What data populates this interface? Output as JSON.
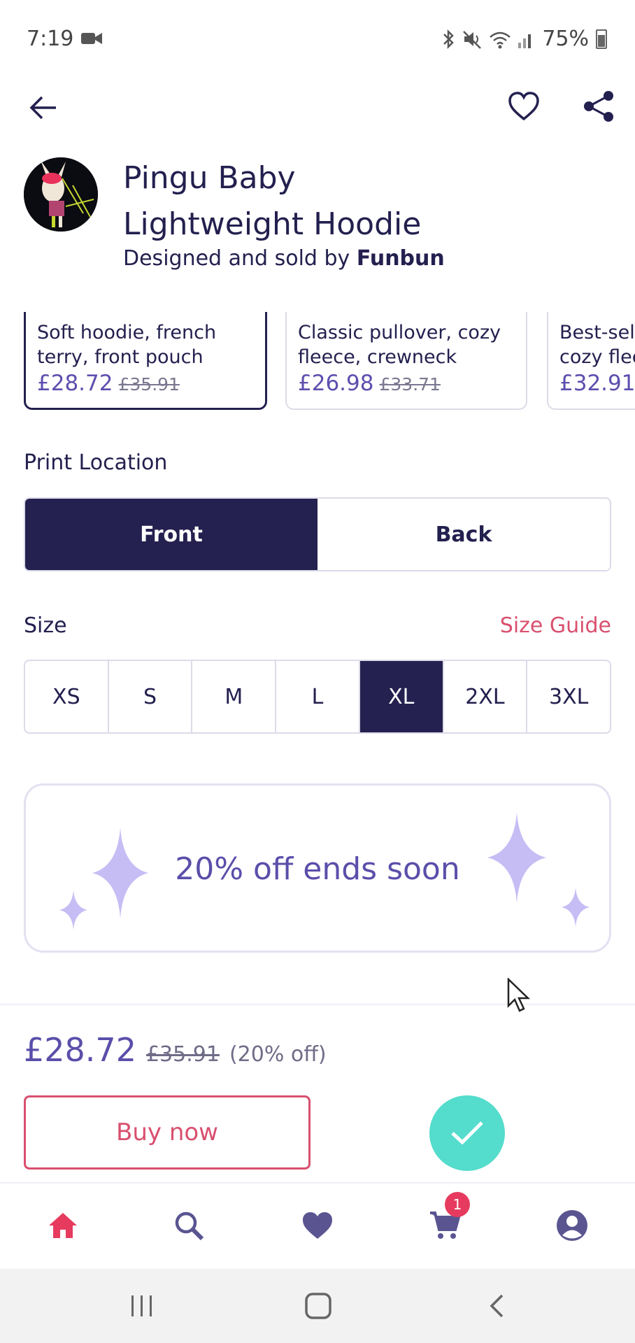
{
  "status_bar": {
    "time": "7:19",
    "battery": "75%",
    "icons": [
      "camera-icon",
      "bluetooth-icon",
      "mute-icon",
      "wifi-icon",
      "signal-icon",
      "battery-icon"
    ]
  },
  "product": {
    "title_line1": "Pingu Baby",
    "title_line2": "Lightweight Hoodie",
    "byline_prefix": "Designed and sold by",
    "seller": "Funbun"
  },
  "variants": [
    {
      "desc_line1": "Soft hoodie, french",
      "desc_line2": "terry, front pouch",
      "price": "£28.72",
      "old_price": "£35.91",
      "selected": true
    },
    {
      "desc_line1": "Classic pullover, cozy",
      "desc_line2": "fleece, crewneck",
      "price": "£26.98",
      "old_price": "£33.71",
      "selected": false
    },
    {
      "desc_line1": "Best-sel",
      "desc_line2": "cozy flee",
      "price": "£32.91",
      "old_price": "",
      "selected": false
    }
  ],
  "print_location": {
    "label": "Print Location",
    "options": [
      "Front",
      "Back"
    ],
    "selected": "Front"
  },
  "size": {
    "label": "Size",
    "guide_label": "Size Guide",
    "options": [
      "XS",
      "S",
      "M",
      "L",
      "XL",
      "2XL",
      "3XL"
    ],
    "selected": "XL"
  },
  "promo": {
    "text": "20% off ends soon"
  },
  "pricing": {
    "price": "£28.72",
    "old_price": "£35.91",
    "discount": "(20% off)"
  },
  "actions": {
    "buy_now": "Buy now"
  },
  "bottom_nav": {
    "items": [
      "home-icon",
      "search-icon",
      "heart-icon",
      "cart-icon",
      "account-icon"
    ],
    "cart_count": "1"
  },
  "colors": {
    "navy": "#24204f",
    "accent_purple": "#5a4eaa",
    "pink": "#d9506f",
    "teal": "#54dccc",
    "sparkle": "#c6bdf5"
  }
}
